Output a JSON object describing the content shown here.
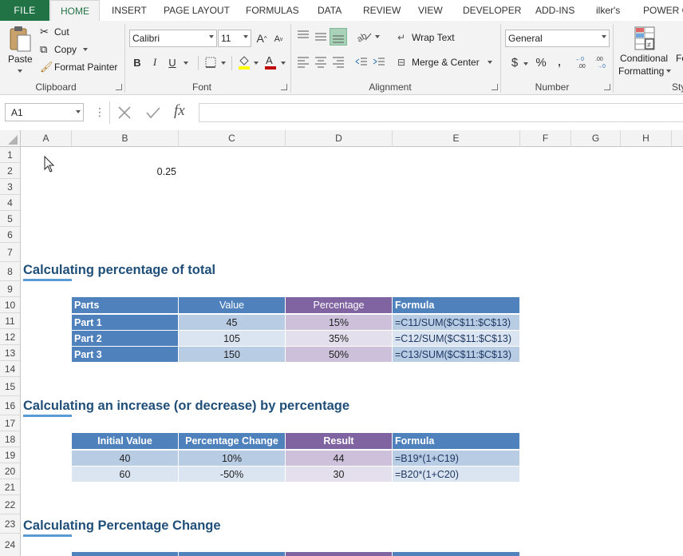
{
  "ribbon_tabs": [
    "FILE",
    "HOME",
    "INSERT",
    "PAGE LAYOUT",
    "FORMULAS",
    "DATA",
    "REVIEW",
    "VIEW",
    "DEVELOPER",
    "ADD-INS",
    "ilker's",
    "POWER Q"
  ],
  "clipboard": {
    "paste": "Paste",
    "cut": "Cut",
    "copy": "Copy",
    "format_painter": "Format Painter",
    "label": "Clipboard"
  },
  "font": {
    "name": "Calibri",
    "size": "11",
    "bold": "B",
    "italic": "I",
    "underline": "U",
    "grow": "A",
    "shrink": "A",
    "label": "Font"
  },
  "alignment": {
    "wrap_text": "Wrap Text",
    "merge_center": "Merge & Center",
    "label": "Alignment"
  },
  "number": {
    "format": "General",
    "currency": "$",
    "percent": "%",
    "comma": ",",
    "inc_dec": ".00",
    "label": "Number"
  },
  "styles": {
    "conditional_formatting_line1": "Conditional",
    "conditional_formatting_line2": "Formatting",
    "next_cut": "Fo",
    "label_cut": "Sty"
  },
  "formula_bar": {
    "name_box": "A1",
    "fx": "fx",
    "value": ""
  },
  "columns": [
    "A",
    "B",
    "C",
    "D",
    "E",
    "F",
    "G",
    "H"
  ],
  "rows": [
    "1",
    "2",
    "3",
    "4",
    "5",
    "6",
    "7",
    "8",
    "9",
    "10",
    "11",
    "12",
    "13",
    "14",
    "15",
    "16",
    "17",
    "18",
    "19",
    "20",
    "21",
    "22",
    "23",
    "24"
  ],
  "cells": {
    "C2": "0.25"
  },
  "section1": {
    "title": "Calculating percentage of total",
    "headers": [
      "Parts",
      "Value",
      "Percentage",
      "Formula"
    ],
    "rows": [
      [
        "Part 1",
        "45",
        "15%",
        "=C11/SUM($C$11:$C$13)"
      ],
      [
        "Part 2",
        "105",
        "35%",
        "=C12/SUM($C$11:$C$13)"
      ],
      [
        "Part 3",
        "150",
        "50%",
        "=C13/SUM($C$11:$C$13)"
      ]
    ]
  },
  "section2": {
    "title": "Calculating an increase (or decrease) by percentage",
    "headers": [
      "Initial Value",
      "Percentage Change",
      "Result",
      "Formula"
    ],
    "rows": [
      [
        "40",
        "10%",
        "44",
        "=B19*(1+C19)"
      ],
      [
        "60",
        "-50%",
        "30",
        "=B20*(1+C20)"
      ]
    ]
  },
  "section3": {
    "title": "Calculating Percentage Change"
  },
  "colors": {
    "excel_green": "#217346",
    "header_blue": "#4f81bd",
    "header_purple": "#8064a2",
    "title_blue": "#1f4e79"
  }
}
